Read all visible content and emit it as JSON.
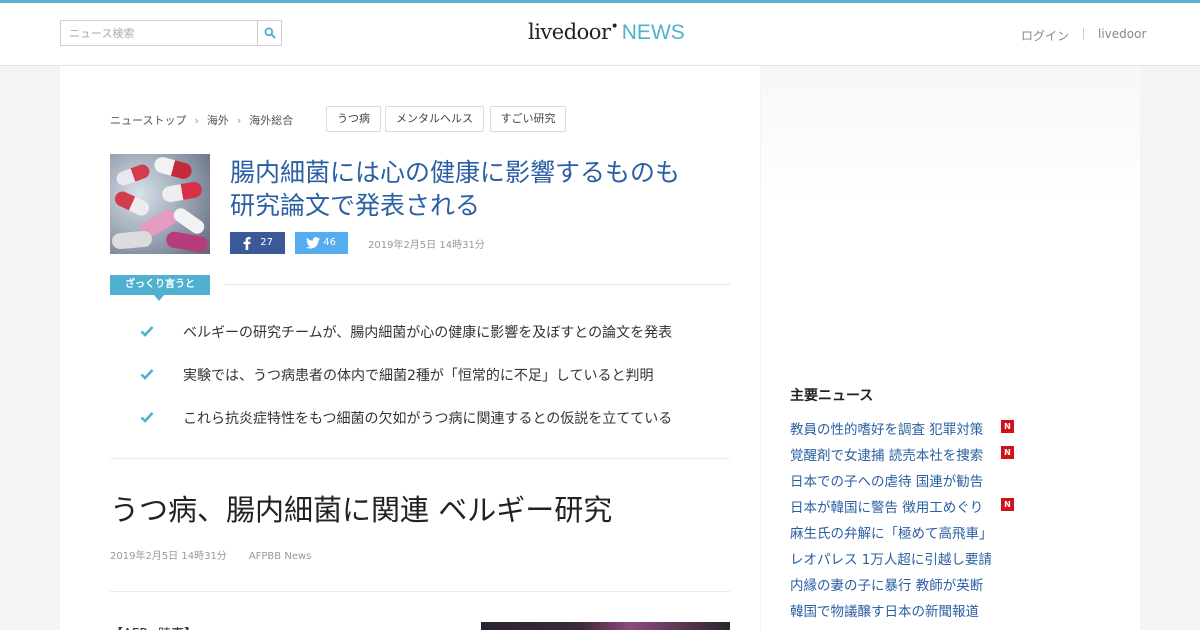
{
  "header": {
    "search_placeholder": "ニュース検索",
    "logo_main": "livedoor",
    "logo_news": "NEWS",
    "login": "ログイン",
    "livedoor_link": "livedoor",
    "accent_color": "#4fb0cf"
  },
  "breadcrumb": [
    "ニューストップ",
    "海外",
    "海外総合"
  ],
  "tags": [
    "うつ病",
    "メンタルヘルス",
    "すごい研究"
  ],
  "article": {
    "headline": "腸内細菌には心の健康に影響するものも研究論文で発表される",
    "headline_line1": "腸内細菌には心の健康に影響するものも",
    "headline_line2": "研究論文で発表される",
    "fb_count": "27",
    "tw_count": "46",
    "date": "2019年2月5日 14時31分",
    "summary_label": "ざっくり言うと",
    "points": [
      "ベルギーの研究チームが、腸内細菌が心の健康に影響を及ぼすとの論文を発表",
      "実験では、うつ病患者の体内で細菌2種が「恒常的に不足」していると判明",
      "これら抗炎症特性をもつ細菌の欠如がうつ病に関連するとの仮説を立てている"
    ],
    "title": "うつ病、腸内細菌に関連 ベルギー研究",
    "source": "AFPBB News"
  },
  "sidebar": {
    "title": "主要ニュース",
    "news": [
      {
        "text": "教員の性的嗜好を調査 犯罪対策",
        "badge": "N"
      },
      {
        "text": "覚醒剤で女逮捕 読売本社を捜索",
        "badge": "N"
      },
      {
        "text": "日本での子への虐待 国連が勧告",
        "badge": ""
      },
      {
        "text": "日本が韓国に警告 徴用工めぐり",
        "badge": "N"
      },
      {
        "text": "麻生氏の弁解に「極めて高飛車」",
        "badge": ""
      },
      {
        "text": "レオパレス 1万人超に引越し要請",
        "badge": ""
      },
      {
        "text": "内縁の妻の子に暴行 教師が英断",
        "badge": ""
      },
      {
        "text": "韓国で物議醸す日本の新聞報道",
        "badge": ""
      }
    ]
  }
}
